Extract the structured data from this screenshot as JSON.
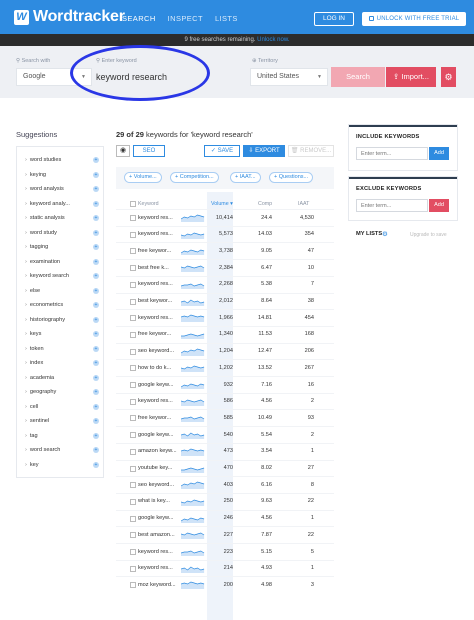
{
  "app": {
    "logo_mark": "W",
    "logo_text": "Wordtracker",
    "nav": [
      "SEARCH",
      "INSPECT",
      "LISTS"
    ],
    "login": "LOG IN",
    "trial": "UNLOCK WITH FREE TRIAL"
  },
  "notice": {
    "text": "9 free searches remaining.",
    "link": "Unlock now."
  },
  "search": {
    "search_with_label": "Search with",
    "search_with_value": "Google",
    "keyword_label": "Enter keyword",
    "keyword_value": "keyword research",
    "territory_label": "Territory",
    "territory_value": "United States",
    "search_button": "Search",
    "import_button": "Import..."
  },
  "suggestions": {
    "title": "Suggestions",
    "items": [
      "word studies",
      "keying",
      "word analysis",
      "keyword analy...",
      "static analysis",
      "word study",
      "tagging",
      "examination",
      "keyword search",
      "else",
      "econometrics",
      "historiography",
      "keys",
      "token",
      "index",
      "academia",
      "geography",
      "cell",
      "sentinel",
      "tag",
      "word search",
      "key"
    ]
  },
  "results": {
    "count_prefix": "29 of 29",
    "count_text": "keywords for 'keyword research'",
    "seo": "SEO",
    "save": "SAVE",
    "export": "EXPORT",
    "remove": "REMOVE...",
    "filters": [
      "Volume...",
      "Competition...",
      "IAAT...",
      "Questions..."
    ],
    "columns": [
      "Keyword",
      "Volume",
      "Comp",
      "IAAT"
    ],
    "rows": [
      {
        "kw": "keyword res...",
        "vol": "10,414",
        "comp": "24.4",
        "iaat": "4,530"
      },
      {
        "kw": "keyword res...",
        "vol": "5,573",
        "comp": "14.03",
        "iaat": "354"
      },
      {
        "kw": "free keywor...",
        "vol": "3,738",
        "comp": "9.05",
        "iaat": "47"
      },
      {
        "kw": "best free k...",
        "vol": "2,384",
        "comp": "6.47",
        "iaat": "10"
      },
      {
        "kw": "keyword res...",
        "vol": "2,268",
        "comp": "5.38",
        "iaat": "7"
      },
      {
        "kw": "best keywor...",
        "vol": "2,012",
        "comp": "8.64",
        "iaat": "38"
      },
      {
        "kw": "keyword res...",
        "vol": "1,966",
        "comp": "14.81",
        "iaat": "454"
      },
      {
        "kw": "free keywor...",
        "vol": "1,340",
        "comp": "11.53",
        "iaat": "168"
      },
      {
        "kw": "seo keyword...",
        "vol": "1,204",
        "comp": "12.47",
        "iaat": "206"
      },
      {
        "kw": "how to do k...",
        "vol": "1,202",
        "comp": "13.52",
        "iaat": "267"
      },
      {
        "kw": "google keyw...",
        "vol": "932",
        "comp": "7.16",
        "iaat": "16"
      },
      {
        "kw": "keyword res...",
        "vol": "586",
        "comp": "4.56",
        "iaat": "2"
      },
      {
        "kw": "free keywor...",
        "vol": "585",
        "comp": "10.49",
        "iaat": "93"
      },
      {
        "kw": "google keyw...",
        "vol": "540",
        "comp": "5.54",
        "iaat": "2"
      },
      {
        "kw": "amazon keyw...",
        "vol": "473",
        "comp": "3.54",
        "iaat": "1"
      },
      {
        "kw": "youtube key...",
        "vol": "470",
        "comp": "8.02",
        "iaat": "27"
      },
      {
        "kw": "seo keyword...",
        "vol": "403",
        "comp": "6.16",
        "iaat": "8"
      },
      {
        "kw": "what is key...",
        "vol": "250",
        "comp": "9.63",
        "iaat": "22"
      },
      {
        "kw": "google keyw...",
        "vol": "246",
        "comp": "4.56",
        "iaat": "1"
      },
      {
        "kw": "best amazon...",
        "vol": "227",
        "comp": "7.87",
        "iaat": "22"
      },
      {
        "kw": "keyword res...",
        "vol": "223",
        "comp": "5.15",
        "iaat": "5"
      },
      {
        "kw": "keyword res...",
        "vol": "214",
        "comp": "4.93",
        "iaat": "1"
      },
      {
        "kw": "moz keyword...",
        "vol": "200",
        "comp": "4.98",
        "iaat": "3"
      }
    ]
  },
  "include": {
    "title": "INCLUDE KEYWORDS",
    "placeholder": "Enter term...",
    "button": "Add"
  },
  "exclude": {
    "title": "EXCLUDE KEYWORDS",
    "placeholder": "Enter term...",
    "button": "Add"
  },
  "mylists": {
    "title": "MY LISTS",
    "link": "Upgrade to save"
  },
  "colors": {
    "brand_blue": "#2e8be0",
    "import_red": "#e24d62",
    "search_pink": "#f2a7b2",
    "annotation_blue": "#2a37e6"
  },
  "icons": {
    "logo": "wordtracker-logo-icon",
    "search": "search-icon",
    "eye": "eye-icon",
    "gear": "gear-icon",
    "plus": "plus-circle-icon"
  }
}
